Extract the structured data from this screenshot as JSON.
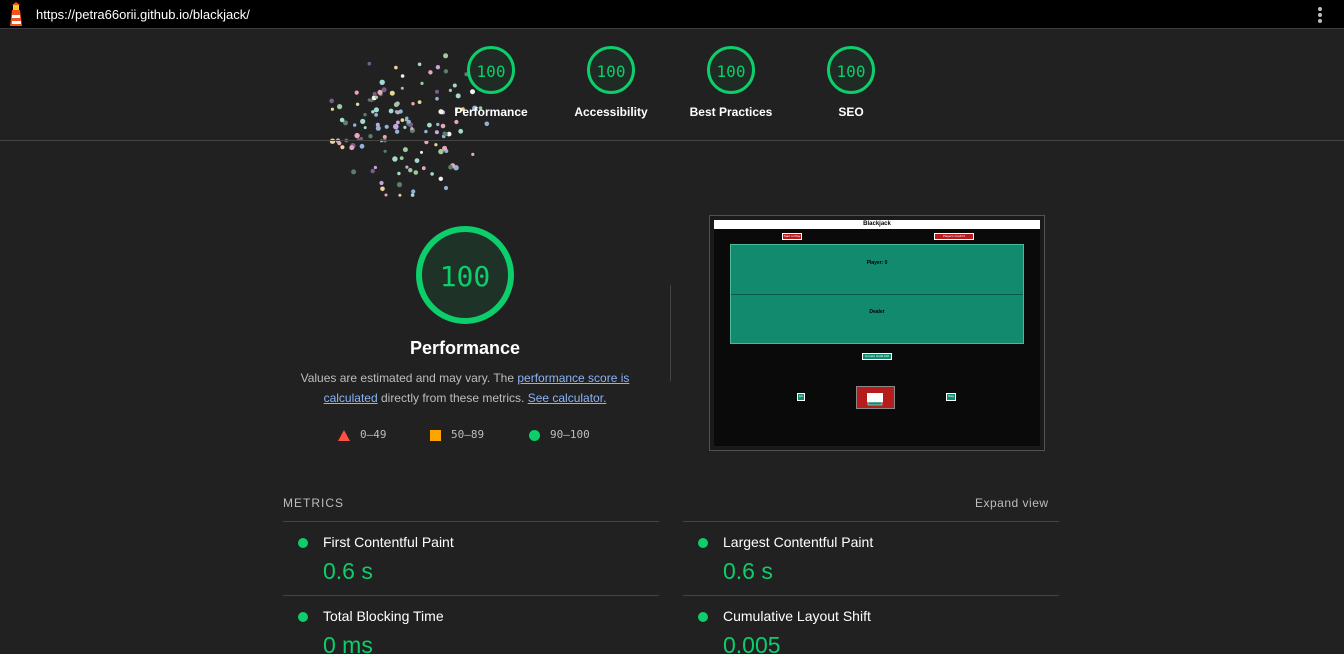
{
  "browser": {
    "url": "https://petra66orii.github.io/blackjack/"
  },
  "summary_gauges": [
    {
      "score": "100",
      "label": "Performance"
    },
    {
      "score": "100",
      "label": "Accessibility"
    },
    {
      "score": "100",
      "label": "Best Practices"
    },
    {
      "score": "100",
      "label": "SEO"
    }
  ],
  "performance": {
    "score": "100",
    "title": "Performance",
    "desc_part1": "Values are estimated and may vary. The ",
    "desc_link1": "performance score is calculated",
    "desc_part2": " directly from these metrics. ",
    "desc_link2": "See calculator."
  },
  "legend": [
    {
      "shape": "triangle",
      "range": "0–49",
      "color": "#ff4e42"
    },
    {
      "shape": "square",
      "range": "50–89",
      "color": "#ffa400"
    },
    {
      "shape": "circle",
      "range": "90–100",
      "color": "#0cce6b"
    }
  ],
  "screenshot": {
    "title": "Blackjack",
    "btn_left": "Start to Play",
    "btn_right": "Player's Credit ▾",
    "player_label": "Player: 0",
    "dealer_label": "Dealer",
    "credit": "Current credit 100",
    "hit": "Hit",
    "stay": "Stay"
  },
  "metrics": {
    "heading": "METRICS",
    "expand": "Expand view",
    "items": [
      {
        "title": "First Contentful Paint",
        "value": "0.6 s"
      },
      {
        "title": "Largest Contentful Paint",
        "value": "0.6 s"
      },
      {
        "title": "Total Blocking Time",
        "value": "0 ms"
      },
      {
        "title": "Cumulative Layout Shift",
        "value": "0.005"
      }
    ]
  },
  "colors": {
    "pass": "#0cce6b",
    "average": "#ffa400",
    "fail": "#ff4e42",
    "background": "#212121"
  }
}
